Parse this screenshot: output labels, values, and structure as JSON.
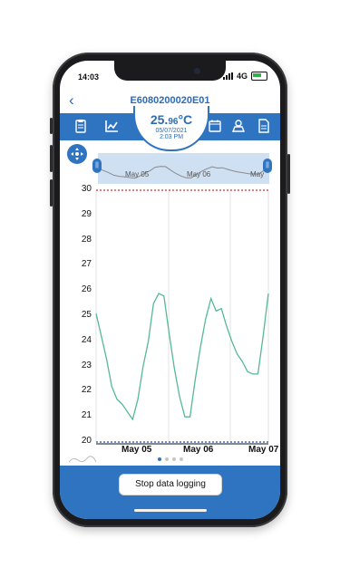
{
  "status": {
    "time": "14:03",
    "network": "4G"
  },
  "header": {
    "device_id": "E6080200020E01",
    "back_icon": "chevron-left-icon"
  },
  "readout": {
    "temp_main": "25.",
    "temp_decimal": "96",
    "unit": "°C",
    "date": "05/07/2021",
    "time": "2:03 PM"
  },
  "toolbar": {
    "icons": [
      "clipboard-icon",
      "chart-icon",
      "calendar-icon",
      "map-user-icon",
      "document-icon"
    ]
  },
  "overview": {
    "labels": [
      "May 05",
      "May 06",
      "May"
    ]
  },
  "chart_data": {
    "type": "line",
    "ylim": [
      20,
      30
    ],
    "yticks": [
      "30",
      "29",
      "28",
      "27",
      "26",
      "25",
      "24",
      "23",
      "22",
      "21",
      "20"
    ],
    "xticks": [
      "May 05",
      "May 06",
      "May 07"
    ],
    "alarm_high": 30,
    "alarm_low": 20,
    "series": [
      {
        "values": [
          25.1,
          24.2,
          23.3,
          22.2,
          21.7,
          21.5,
          21.2,
          20.9,
          21.7,
          23.0,
          24.0,
          25.5,
          25.9,
          25.8,
          24.3,
          22.9,
          21.8,
          21.0,
          21.0,
          22.5,
          23.8,
          24.9,
          25.7,
          25.2,
          25.3,
          24.6,
          24.0,
          23.5,
          23.2,
          22.8,
          22.7,
          22.7,
          24.2,
          25.9
        ]
      }
    ],
    "color": "#56b89b"
  },
  "footer": {
    "stop_button": "Stop data logging"
  },
  "colors": {
    "primary": "#2f74c0",
    "alarm": "#d0312d",
    "low": "#1f4fa0"
  }
}
